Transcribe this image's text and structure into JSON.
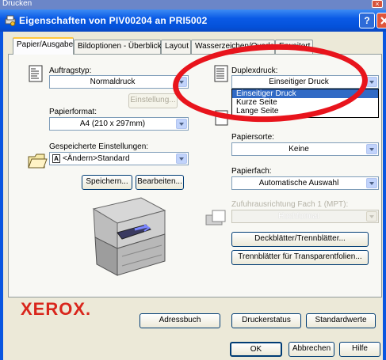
{
  "background_window": {
    "title": "Drucken"
  },
  "dialog": {
    "title": "Eigenschaften von PIV00204 an PRI5002",
    "help": "?"
  },
  "tabs": [
    "Papier/Ausgabe",
    "Bildoptionen - Überblick",
    "Layout",
    "Wasserzeichen/Overlay",
    "Erweitert"
  ],
  "left": {
    "auftragstyp_label": "Auftragstyp:",
    "auftragstyp_value": "Normaldruck",
    "einstellung_button": "Einstellung...",
    "papierformat_label": "Papierformat:",
    "papierformat_value": "A4 (210 x 297mm)",
    "gespeicherte_label": "Gespeicherte Einstellungen:",
    "gespeicherte_badge": "A",
    "gespeicherte_value": "<Ändern>Standard",
    "speichern_button": "Speichern...",
    "bearbeiten_button": "Bearbeiten..."
  },
  "right": {
    "duplex_label": "Duplexdruck:",
    "duplex_value": "Einseitiger Druck",
    "duplex_options": [
      "Einseitiger Druck",
      "Kurze Seite",
      "Lange Seite"
    ],
    "papiersorte_label": "Papiersorte:",
    "papiersorte_value": "Keine",
    "papierfach_label": "Papierfach:",
    "papierfach_value": "Automatische Auswahl",
    "zufuhr_label": "Zufuhrausrichtung Fach 1 (MPT):",
    "zufuhr_value": "Hochformat",
    "deckblaetter_button": "Deckblätter/Trennblätter...",
    "trennblaetter_button": "Trennblätter für Transparentfolien..."
  },
  "brand": "XEROX.",
  "bottom_buttons": {
    "adressbuch": "Adressbuch",
    "druckerstatus": "Druckerstatus",
    "standardwerte": "Standardwerte"
  },
  "footer_buttons": {
    "ok": "OK",
    "abbrechen": "Abbrechen",
    "hilfe": "Hilfe"
  },
  "colors": {
    "titlebar": "#0a5ae6",
    "selection": "#316ac5",
    "annotation_circle": "#e8141c",
    "brand": "#d9261c"
  }
}
